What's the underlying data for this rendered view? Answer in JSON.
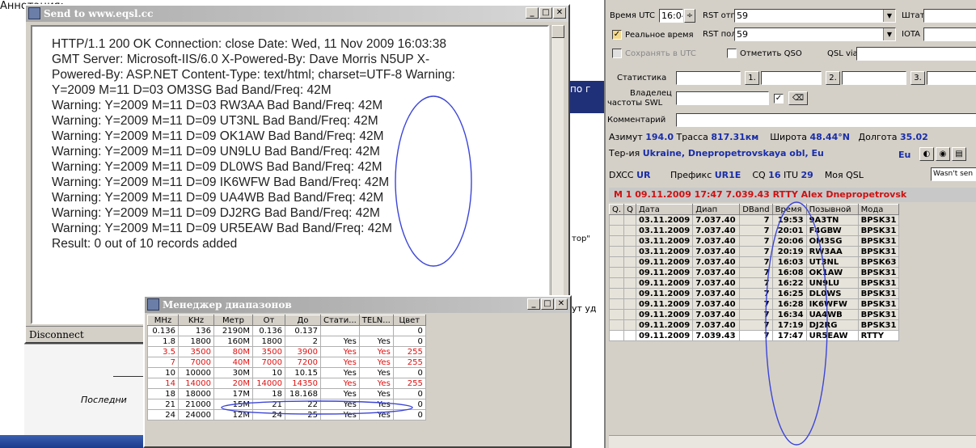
{
  "caption": "Аннотация:",
  "background": {
    "frag_po": "по г",
    "frag_tor": "тор\"",
    "frag_ut": "ут уд",
    "frag_last": "Последни"
  },
  "eqsl": {
    "title": "Send to www.eqsl.cc",
    "lines": [
      "HTTP/1.1 200 OK Connection: close Date: Wed, 11 Nov 2009 16:03:38",
      "GMT Server: Microsoft-IIS/6.0 X-Powered-By: Dave Morris N5UP X-",
      "Powered-By: ASP.NET Content-Type: text/html; charset=UTF-8 Warning:",
      "Y=2009 M=11 D=03 OM3SG Bad Band/Freq: 42M",
      "Warning: Y=2009 M=11 D=03 RW3AA Bad Band/Freq: 42M",
      "Warning: Y=2009 M=11 D=09 UT3NL Bad Band/Freq: 42M",
      "Warning: Y=2009 M=11 D=09 OK1AW Bad Band/Freq: 42M",
      "Warning: Y=2009 M=11 D=09 UN9LU Bad Band/Freq: 42M",
      "Warning: Y=2009 M=11 D=09 DL0WS Bad Band/Freq: 42M",
      "Warning: Y=2009 M=11 D=09 IK6WFW Bad Band/Freq: 42M",
      "Warning: Y=2009 M=11 D=09 UA4WB Bad Band/Freq: 42M",
      "Warning: Y=2009 M=11 D=09 DJ2RG Bad Band/Freq: 42M",
      "Warning: Y=2009 M=11 D=09 UR5EAW Bad Band/Freq: 42M",
      "Result: 0 out of 10 records added"
    ],
    "status": "Disconnect"
  },
  "bandmgr": {
    "title": "Менеджер диапазонов",
    "headers": [
      "MHz",
      "KHz",
      "Метр",
      "От",
      "До",
      "Стати...",
      "TELN...",
      "Цвет"
    ],
    "rows": [
      {
        "red": false,
        "cells": [
          "0.136",
          "136",
          "2190M",
          "0.136",
          "0.137",
          "",
          "",
          "0"
        ]
      },
      {
        "red": false,
        "cells": [
          "1.8",
          "1800",
          "160M",
          "1800",
          "2",
          "Yes",
          "Yes",
          "0"
        ]
      },
      {
        "red": true,
        "cells": [
          "3.5",
          "3500",
          "80M",
          "3500",
          "3900",
          "Yes",
          "Yes",
          "255"
        ]
      },
      {
        "red": true,
        "cells": [
          "7",
          "7000",
          "40M",
          "7000",
          "7200",
          "Yes",
          "Yes",
          "255"
        ]
      },
      {
        "red": false,
        "cells": [
          "10",
          "10000",
          "30M",
          "10",
          "10.15",
          "Yes",
          "Yes",
          "0"
        ]
      },
      {
        "red": true,
        "cells": [
          "14",
          "14000",
          "20M",
          "14000",
          "14350",
          "Yes",
          "Yes",
          "255"
        ]
      },
      {
        "red": false,
        "cells": [
          "18",
          "18000",
          "17M",
          "18",
          "18.168",
          "Yes",
          "Yes",
          "0"
        ]
      },
      {
        "red": false,
        "cells": [
          "21",
          "21000",
          "15M",
          "21",
          "22",
          "Yes",
          "Yes",
          "0"
        ]
      },
      {
        "red": false,
        "cells": [
          "24",
          "24000",
          "12M",
          "24",
          "25",
          "Yes",
          "Yes",
          "0"
        ]
      }
    ]
  },
  "logger": {
    "time_label": "Время UTC",
    "time_value": "16:04",
    "rst_sent_label": "RST отп",
    "rst_sent_value": "59",
    "rst_rcvd_label": "RST пол",
    "rst_rcvd_value": "59",
    "state_label": "Штат",
    "iota_label": "IOTA",
    "realtime_label": "Реальное время",
    "save_utc_label": "Сохранять в UTC",
    "mark_qso_label": "Отметить QSO",
    "qsl_via_label": "QSL via",
    "stats_label": "Статистика",
    "btn1": "1.",
    "btn2": "2.",
    "btn3": "3.",
    "owner_label_1": "Владелец",
    "owner_label_2": "частоты SWL",
    "comment_label": "Комментарий",
    "azimuth_label": "Азимут",
    "azimuth_value": "194.0",
    "path_label": "Трасса",
    "path_value": "817.31км",
    "lat_label": "Широта",
    "lat_value": "48.44°N",
    "lon_label": "Долгота",
    "lon_value": "35.02",
    "territory_label": "Тер-ия",
    "territory_value": "Ukraine, Dnepropetrovskaya obl, Eu",
    "continent": "Eu",
    "dxcc_label": "DXCC",
    "dxcc_value": "UR",
    "prefix_label": "Префикс",
    "prefix_value": "UR1E",
    "cq_label": "CQ",
    "cq_value": "16",
    "itu_label": "ITU",
    "itu_value": "29",
    "myqsl_label": "Моя QSL",
    "myqsl_value": "Wasn't sen",
    "current_line": "М  1   09.11.2009   17:47   7.039.43   RTTY   Alex   Dnepropetrovsk",
    "qso_headers": [
      "Q.",
      "Q",
      "Дата",
      "Диап",
      "DBand",
      "Время",
      "Позывной",
      "Мода"
    ],
    "qso_rows": [
      {
        "cur": false,
        "cells": [
          "",
          "",
          "03.11.2009",
          "7.037.40",
          "7",
          "19:53",
          "9A3TN",
          "BPSK31"
        ]
      },
      {
        "cur": false,
        "cells": [
          "",
          "",
          "03.11.2009",
          "7.037.40",
          "7",
          "20:01",
          "F4GBW",
          "BPSK31"
        ]
      },
      {
        "cur": false,
        "cells": [
          "",
          "",
          "03.11.2009",
          "7.037.40",
          "7",
          "20:06",
          "OM3SG",
          "BPSK31"
        ]
      },
      {
        "cur": false,
        "cells": [
          "",
          "",
          "03.11.2009",
          "7.037.40",
          "7",
          "20:19",
          "RW3AA",
          "BPSK31"
        ]
      },
      {
        "cur": false,
        "cells": [
          "",
          "",
          "09.11.2009",
          "7.037.40",
          "7",
          "16:03",
          "UT3NL",
          "BPSK63"
        ]
      },
      {
        "cur": false,
        "cells": [
          "",
          "",
          "09.11.2009",
          "7.037.40",
          "7",
          "16:08",
          "OK1AW",
          "BPSK31"
        ]
      },
      {
        "cur": false,
        "cells": [
          "",
          "",
          "09.11.2009",
          "7.037.40",
          "7",
          "16:22",
          "UN9LU",
          "BPSK31"
        ]
      },
      {
        "cur": false,
        "cells": [
          "",
          "",
          "09.11.2009",
          "7.037.40",
          "7",
          "16:25",
          "DL0WS",
          "BPSK31"
        ]
      },
      {
        "cur": false,
        "cells": [
          "",
          "",
          "09.11.2009",
          "7.037.40",
          "7",
          "16:28",
          "IK6WFW",
          "BPSK31"
        ]
      },
      {
        "cur": false,
        "cells": [
          "",
          "",
          "09.11.2009",
          "7.037.40",
          "7",
          "16:34",
          "UA4WB",
          "BPSK31"
        ]
      },
      {
        "cur": false,
        "cells": [
          "",
          "",
          "09.11.2009",
          "7.037.40",
          "7",
          "17:19",
          "DJ2RG",
          "BPSK31"
        ]
      },
      {
        "cur": true,
        "cells": [
          "",
          "",
          "09.11.2009",
          "7.039.43",
          "7",
          "17:47",
          "UR5EAW",
          "RTTY"
        ]
      }
    ]
  }
}
